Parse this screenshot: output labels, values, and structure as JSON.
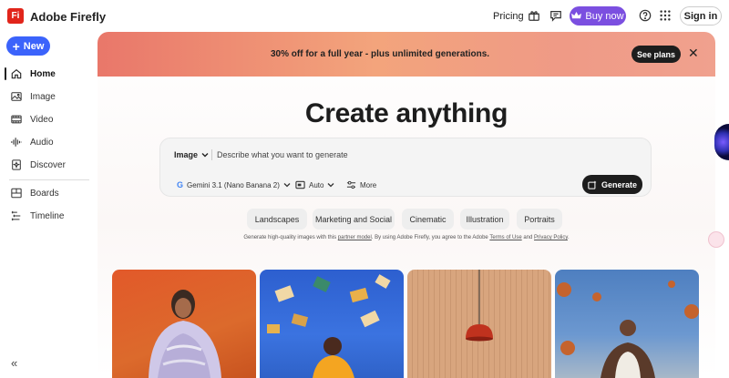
{
  "app": {
    "logo_text": "Fi",
    "title": "Adobe Firefly"
  },
  "topbar": {
    "pricing_label": "Pricing",
    "buy_label": "Buy now",
    "signin_label": "Sign in",
    "icons": [
      "gift-icon",
      "chat-icon",
      "crown-icon",
      "help-icon",
      "apps-grid-icon"
    ]
  },
  "sidebar": {
    "new_label": "New",
    "items": [
      {
        "label": "Home",
        "icon": "home-icon",
        "active": true
      },
      {
        "label": "Image",
        "icon": "image-icon"
      },
      {
        "label": "Video",
        "icon": "video-icon"
      },
      {
        "label": "Audio",
        "icon": "audio-icon"
      },
      {
        "label": "Discover",
        "icon": "discover-icon"
      },
      {
        "label": "Boards",
        "icon": "boards-icon"
      },
      {
        "label": "Timeline",
        "icon": "timeline-icon"
      }
    ],
    "collapse_icon": "collapse-icon"
  },
  "promo": {
    "text": "30% off for a full year  - plus unlimited generations.",
    "cta": "See plans"
  },
  "hero": {
    "headline": "Create anything"
  },
  "prompt": {
    "type_label": "Image",
    "placeholder": "Describe what you want to generate",
    "model_label": "Gemini 3.1 (Nano Banana 2)",
    "aspect_label": "Auto",
    "more_label": "More",
    "generate_label": "Generate"
  },
  "chips": [
    "Landscapes",
    "Marketing and Social",
    "Cinematic",
    "Illustration",
    "Portraits"
  ],
  "terms": {
    "part1": "Generate high-quality images with this ",
    "link1": "partner model",
    "part2": ". By using Adobe Firefly, you agree to the Adobe ",
    "link2": "Terms of Use",
    "part3": " and ",
    "link3": "Privacy Policy",
    "part4": "."
  },
  "colors": {
    "accent": "#3b63fb",
    "buy": "#7b4fe0",
    "brand": "#e1251b",
    "dark": "#1d1d1d"
  }
}
